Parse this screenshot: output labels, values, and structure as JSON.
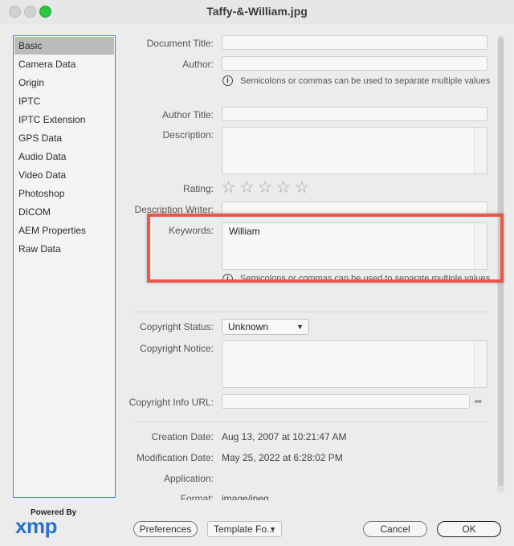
{
  "window": {
    "title": "Taffy-&-William.jpg"
  },
  "sidebar": {
    "items": [
      {
        "label": "Basic",
        "selected": true
      },
      {
        "label": "Camera Data"
      },
      {
        "label": "Origin"
      },
      {
        "label": "IPTC"
      },
      {
        "label": "IPTC Extension"
      },
      {
        "label": "GPS Data"
      },
      {
        "label": "Audio Data"
      },
      {
        "label": "Video Data"
      },
      {
        "label": "Photoshop"
      },
      {
        "label": "DICOM"
      },
      {
        "label": "AEM Properties"
      },
      {
        "label": "Raw Data"
      }
    ]
  },
  "fields": {
    "document_title": {
      "label": "Document Title:",
      "value": ""
    },
    "author": {
      "label": "Author:",
      "value": ""
    },
    "author_hint": "Semicolons or commas can be used to separate multiple values",
    "author_title": {
      "label": "Author Title:",
      "value": ""
    },
    "description": {
      "label": "Description:",
      "value": ""
    },
    "rating": {
      "label": "Rating:",
      "value": 0,
      "max": 5
    },
    "description_writer": {
      "label": "Description Writer:",
      "value": ""
    },
    "keywords": {
      "label": "Keywords:",
      "value": "William"
    },
    "keywords_hint": "Semicolons or commas can be used to separate multiple values",
    "copyright_status": {
      "label": "Copyright Status:",
      "value": "Unknown"
    },
    "copyright_notice": {
      "label": "Copyright Notice:",
      "value": ""
    },
    "copyright_url": {
      "label": "Copyright Info URL:",
      "value": ""
    },
    "creation_date": {
      "label": "Creation Date:",
      "value": "Aug 13, 2007 at 10:21:47 AM"
    },
    "modification_date": {
      "label": "Modification Date:",
      "value": "May 25, 2022 at 6:28:02 PM"
    },
    "application": {
      "label": "Application:",
      "value": ""
    },
    "format": {
      "label": "Format:",
      "value": "image/jpeg"
    }
  },
  "footer": {
    "powered_by": "Powered By",
    "logo": "xmp",
    "preferences": "Preferences",
    "template": "Template Fo...",
    "cancel": "Cancel",
    "ok": "OK"
  },
  "colors": {
    "accent": "#3b82f6",
    "highlight": "#e8574b",
    "xmp_blue": "#2b73c9"
  },
  "icons": {
    "info": "info-icon",
    "star": "star-icon",
    "chevron": "chevron-down-icon",
    "arrow": "arrow-right-icon"
  }
}
